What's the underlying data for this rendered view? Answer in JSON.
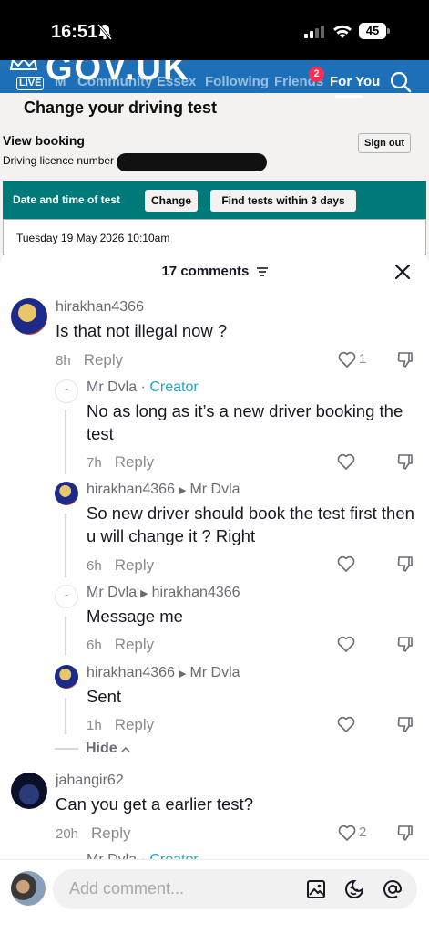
{
  "status_bar": {
    "time": "16:51",
    "battery": "45"
  },
  "gov_page": {
    "brand": "GOV.UK",
    "title": "Change your driving test",
    "view_booking": "View booking",
    "licence_label": "Driving licence number",
    "sign_out": "Sign out",
    "panel_label": "Date and time of test",
    "change_button": "Change",
    "find_button": "Find tests within 3 days",
    "test_date": "Tuesday 19 May 2026 10:10am"
  },
  "top_tabs": {
    "live": "LIVE",
    "tabs": [
      "M",
      "Community",
      "Essex",
      "Following",
      "Friends",
      "For You"
    ],
    "friends_badge": "2"
  },
  "comments_header": {
    "count_text": "17 comments"
  },
  "comments": [
    {
      "user": "hirakhan4366",
      "text": "Is that not illegal now ?",
      "time": "8h",
      "reply": "Reply",
      "likes": "1"
    },
    {
      "user": "Mr Dvla",
      "creator": "Creator",
      "text": "No as long as it’s a new driver booking the test",
      "time": "7h",
      "reply": "Reply"
    },
    {
      "user": "hirakhan4366",
      "to": "Mr Dvla",
      "text": "So new driver should book the test first then u will change it ? Right",
      "time": "6h",
      "reply": "Reply"
    },
    {
      "user": "Mr Dvla",
      "to": "hirakhan4366",
      "text": "Message me",
      "time": "6h",
      "reply": "Reply"
    },
    {
      "user": "hirakhan4366",
      "to": "Mr Dvla",
      "text": "Sent",
      "time": "1h",
      "reply": "Reply"
    },
    {
      "user": "jahangir62",
      "text": "Can you get a earlier test?",
      "time": "20h",
      "reply": "Reply",
      "likes": "2"
    }
  ],
  "partial_next": {
    "user": "Mr Dvla",
    "creator": "Creator"
  },
  "hide_label": "Hide",
  "composer": {
    "placeholder": "Add comment..."
  },
  "colors": {
    "accent": "#fe2c55",
    "creator": "#20a6c4",
    "gov_blue": "#1d70b8",
    "panel": "#007a78"
  }
}
